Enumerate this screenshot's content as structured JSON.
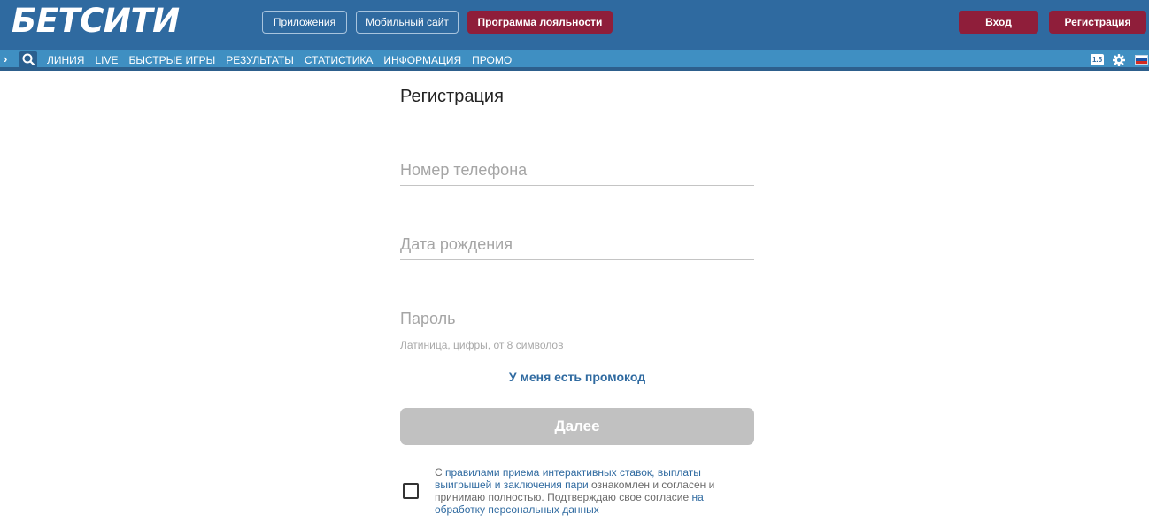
{
  "header": {
    "logo": "БЕТСИТИ",
    "apps_label": "Приложения",
    "mobile_label": "Мобильный сайт",
    "loyalty_label": "Программа лояльности",
    "login_label": "Вход",
    "register_label": "Регистрация"
  },
  "nav": {
    "items": [
      "ЛИНИЯ",
      "LIVE",
      "БЫСТРЫЕ ИГРЫ",
      "РЕЗУЛЬТАТЫ",
      "СТАТИСТИКА",
      "ИНФОРМАЦИЯ",
      "ПРОМО"
    ],
    "badge": "1.5",
    "icons": [
      "chevron-right-icon",
      "search-icon",
      "gear-icon",
      "russia-flag-icon"
    ]
  },
  "form": {
    "title": "Регистрация",
    "phone_placeholder": "Номер телефона",
    "birth_placeholder": "Дата рождения",
    "password_placeholder": "Пароль",
    "password_hint": "Латиница, цифры, от 8 символов",
    "promo_link": "У меня есть промокод",
    "submit_label": "Далее",
    "agreement": {
      "prefix": "С ",
      "rules_link": "правилами приема интерактивных ставок, выплаты выигрышей и заключения пари",
      "middle": " ознакомлен и согласен и принимаю полностью. Подтверждаю свое согласие ",
      "consent_link": "на обработку персональных данных"
    }
  },
  "colors": {
    "header_bg": "#2f6aa0",
    "nav_bg": "#3f8fc2",
    "accent_red": "#8f1e3a",
    "link_blue": "#2f6aa0",
    "disabled_button": "#c1c1c1"
  }
}
